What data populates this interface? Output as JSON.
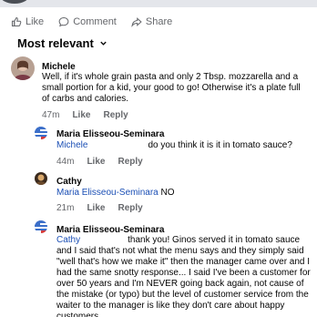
{
  "actions": {
    "like": "Like",
    "comment": "Comment",
    "share": "Share"
  },
  "sort": {
    "label": "Most relevant"
  },
  "comments": [
    {
      "name": "Michele",
      "text": "Well, if it's whole grain pasta and only 2 Tbsp. mozzarella and a small portion for a kid, your good to go! Otherwise it's a plate full of carbs and calories.",
      "time": "47m",
      "like": "Like",
      "reply": "Reply"
    },
    {
      "name": "Maria Elisseou-Seminara",
      "mention": "Michele",
      "text": "do you think it is it in tomato sauce?",
      "time": "44m",
      "like": "Like",
      "reply": "Reply"
    },
    {
      "name": "Cathy",
      "mention": "Maria Elisseou-Seminara",
      "text": "NO",
      "time": "21m",
      "like": "Like",
      "reply": "Reply"
    },
    {
      "name": "Maria Elisseou-Seminara",
      "mention": "Cathy",
      "text": "thank you! Ginos served it in tomato sauce and I said that's not what the menu says and they simply said \"well that's how we make it\" then the manager came over and I had the same snotty response... I said I've been a customer for over 50 years and I'm NEVER going back again, not cause of the mistake (or typo) but the level of customer service from the waiter to the manager is like they don't care about happy customers"
    }
  ],
  "colors": {
    "meta_gray": "#65676b",
    "mention_blue": "#1b4fb5"
  }
}
